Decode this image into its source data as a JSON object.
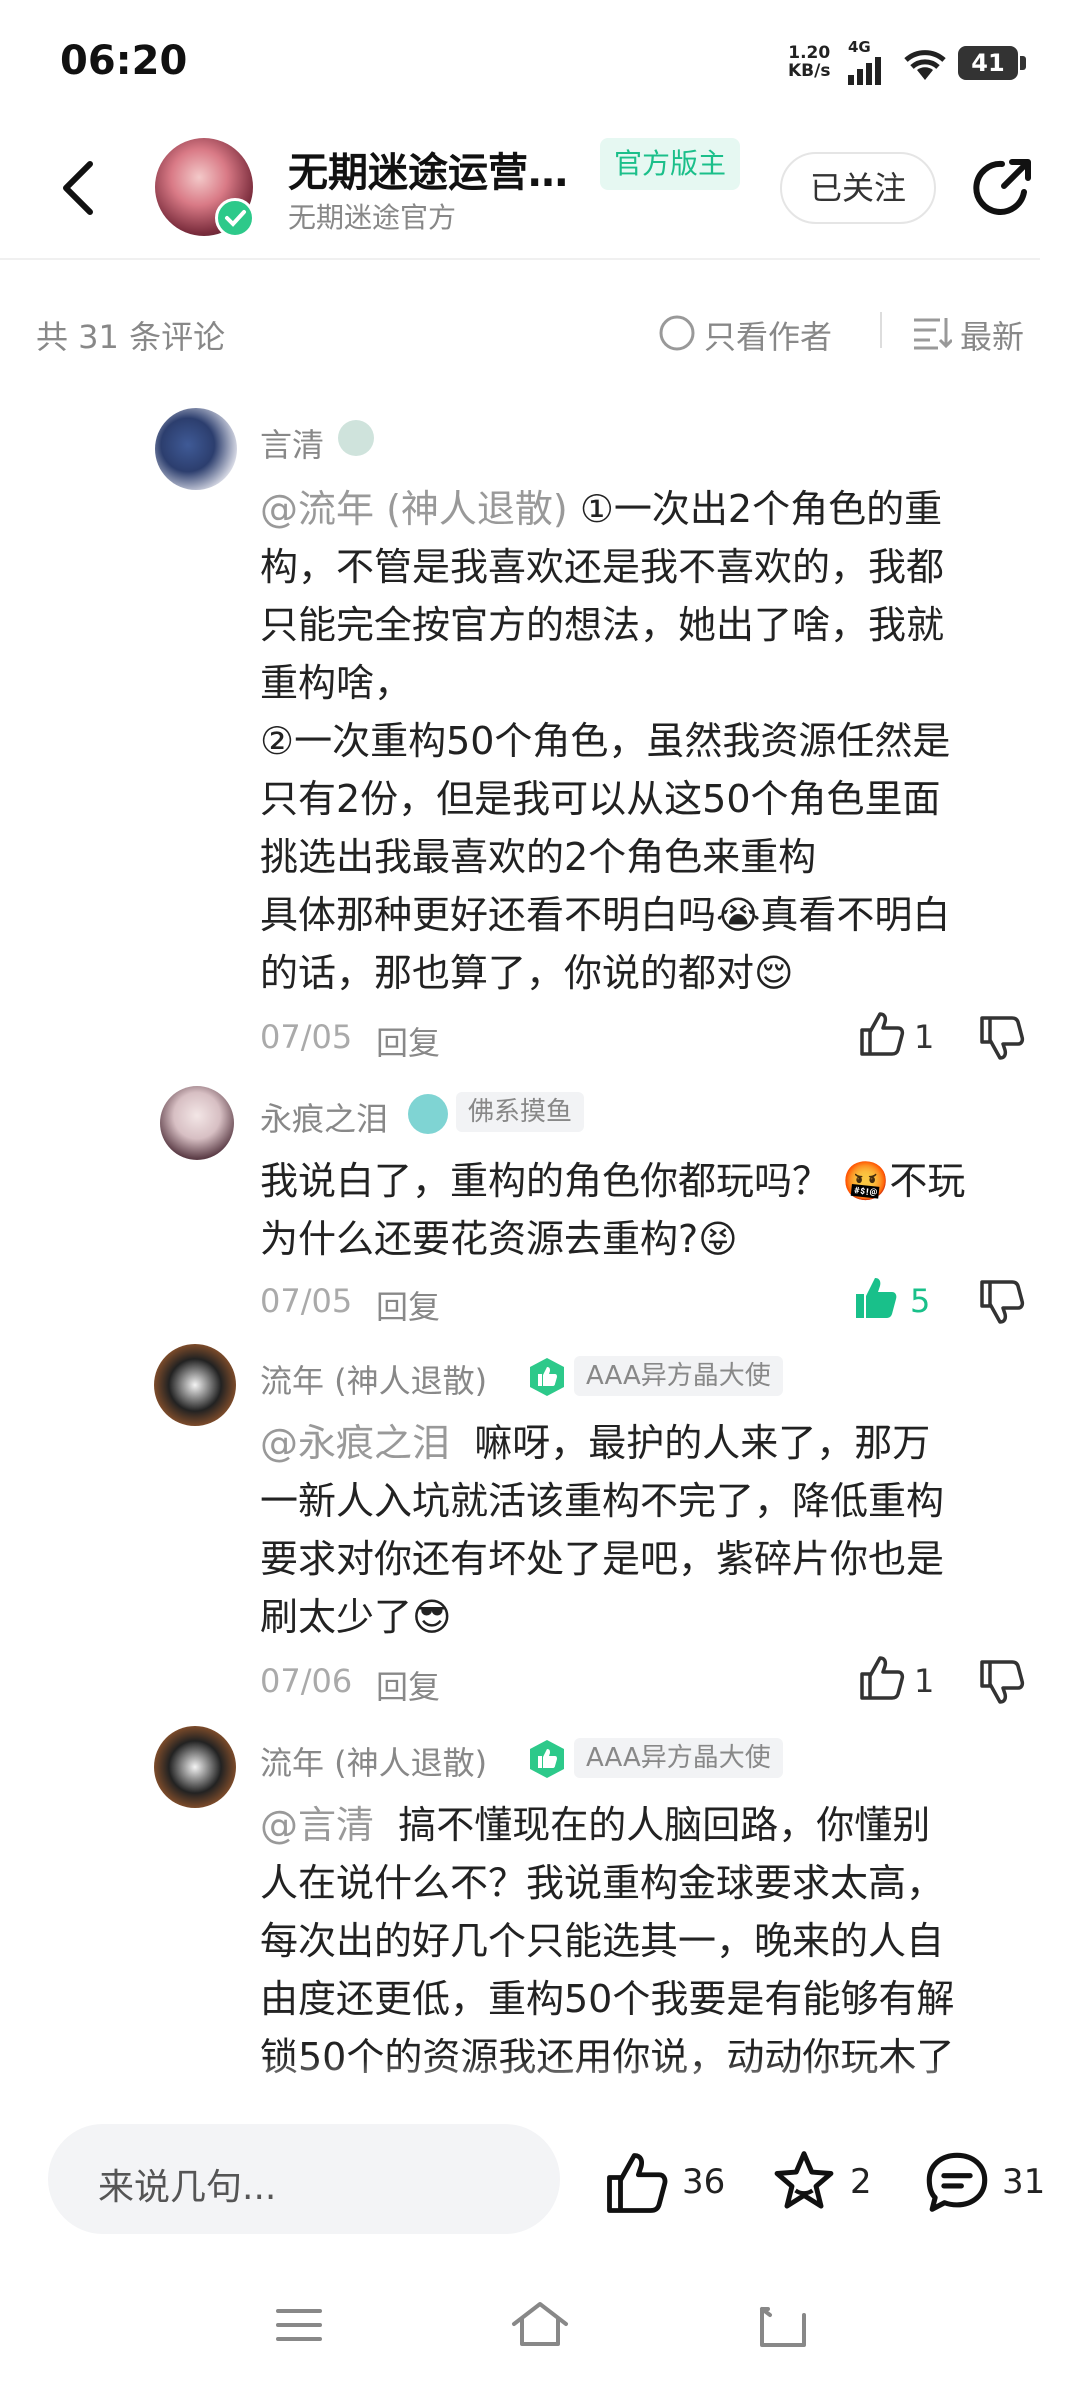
{
  "status_bar": {
    "time": "06:20",
    "net_speed_value": "1.20",
    "net_speed_unit": "KB/s",
    "network": "4G",
    "battery": "41"
  },
  "header": {
    "title": "无期迷途运营…",
    "subtitle": "无期迷途官方",
    "badge": "官方版主",
    "follow_label": "已关注"
  },
  "toolbar": {
    "comment_count": "共 31 条评论",
    "only_author": "只看作者",
    "sort_label": "最新"
  },
  "comments": [
    {
      "name": "言清",
      "mention": "@流年 (神人退散)",
      "text_lines": [
        "①一次出2个角色的重",
        "构，不管是我喜欢还是我不喜欢的，我都",
        "只能完全按官方的想法，她出了啥，我就",
        "重构啥，",
        "②一次重构50个角色，虽然我资源任然是",
        "只有2份，但是我可以从这50个角色里面",
        "挑选出我最喜欢的2个角色来重构",
        "具体那种更好还看不明白吗😭真看不明白",
        "的话，那也算了，你说的都对😌"
      ],
      "date": "07/05",
      "reply": "回复",
      "likes": "1"
    },
    {
      "name": "永痕之泪",
      "tag": "佛系摸鱼",
      "text_lines": [
        "我说白了，重构的角色你都玩吗？ 🤬不玩",
        "为什么还要花资源去重构?😝"
      ],
      "date": "07/05",
      "reply": "回复",
      "likes": "5"
    },
    {
      "name": "流年 (神人退散)",
      "tag": "AAA异方晶大使",
      "mention": "@永痕之泪",
      "text_lines": [
        "嘛呀，最护的人来了，那万",
        "一新人入坑就活该重构不完了，降低重构",
        "要求对你还有坏处了是吧，紫碎片你也是",
        "刷太少了😎"
      ],
      "date": "07/06",
      "reply": "回复",
      "likes": "1"
    },
    {
      "name": "流年 (神人退散)",
      "tag": "AAA异方晶大使",
      "mention": "@言清",
      "text_lines": [
        "搞不懂现在的人脑回路，你懂别",
        "人在说什么不？我说重构金球要求太高，",
        "每次出的好几个只能选其一，晚来的人自",
        "由度还更低，重构50个我要是有能够有解",
        "锁50个的资源我还用你说，动动你玩木了"
      ]
    }
  ],
  "bottom": {
    "placeholder": "来说几句...",
    "likes": "36",
    "favorites": "2",
    "comments": "31"
  },
  "colors": {
    "accent": "#1bbf8a",
    "liked": "#19c08a"
  },
  "icons": [
    "back-icon",
    "share-icon",
    "radio-icon",
    "sort-icon",
    "thumbs-up-icon",
    "thumbs-down-icon",
    "star-icon",
    "comment-icon",
    "menu-icon",
    "home-icon",
    "return-icon"
  ]
}
